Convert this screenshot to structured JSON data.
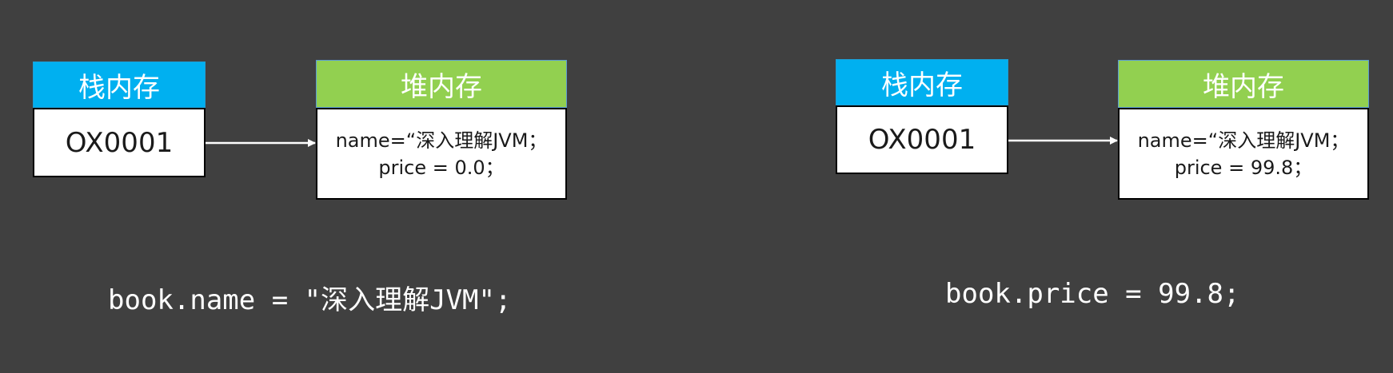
{
  "left": {
    "stack_header": "栈内存",
    "heap_header": "堆内存",
    "address": "OX0001",
    "heap_fields": [
      "name=“深入理解JVM；",
      "price = 0.0；"
    ],
    "code": "book.name = \"深入理解JVM\";"
  },
  "right": {
    "stack_header": "栈内存",
    "heap_header": "堆内存",
    "address": "OX0001",
    "heap_fields": [
      "name=“深入理解JVM；",
      "price = 99.8；"
    ],
    "code": "book.price = 99.8;"
  },
  "colors": {
    "background": "#404040",
    "stack_header": "#00b0f0",
    "heap_header": "#92d050",
    "box_fill": "#ffffff",
    "arrow": "#ffffff"
  }
}
